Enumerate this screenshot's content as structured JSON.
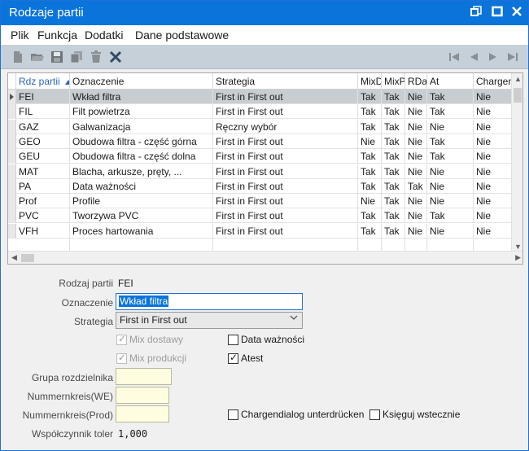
{
  "window": {
    "title": "Rodzaje partii",
    "controls": [
      "restore-icon",
      "maximize-icon",
      "close-icon"
    ]
  },
  "menu": {
    "items": [
      "Plik",
      "Funkcja",
      "Dodatki",
      "Dane podstawowe"
    ]
  },
  "toolbar": {
    "left_icons": [
      "new-document-icon",
      "open-folder-icon",
      "save-icon",
      "copy-icon",
      "delete-icon",
      "cancel-icon"
    ],
    "right_icons": [
      "first-record-icon",
      "previous-record-icon",
      "next-record-icon",
      "last-record-icon"
    ]
  },
  "grid": {
    "columns": [
      "Rdz partii",
      "Oznaczenie",
      "Strategia",
      "MixD",
      "MixP",
      "RDaW",
      "At",
      "Chargen"
    ],
    "sorted_column": "Rdz partii",
    "sort_direction": "ascending",
    "selected_row": 0,
    "rows": [
      [
        "FEI",
        "Wkład filtra",
        "First in First out",
        "Tak",
        "Tak",
        "Nie",
        "Tak",
        "Nie"
      ],
      [
        "FIL",
        "Filt powietrza",
        "First in First out",
        "Tak",
        "Tak",
        "Nie",
        "Tak",
        "Nie"
      ],
      [
        "GAZ",
        "Galwanizacja",
        "Ręczny wybór",
        "Tak",
        "Tak",
        "Nie",
        "Nie",
        "Nie"
      ],
      [
        "GEO",
        "Obudowa filtra - część górna",
        "First in First out",
        "Nie",
        "Tak",
        "Nie",
        "Tak",
        "Nie"
      ],
      [
        "GEU",
        "Obudowa filtra - część dolna",
        "First in First out",
        "Tak",
        "Tak",
        "Nie",
        "Tak",
        "Nie"
      ],
      [
        "MAT",
        "Blacha, arkusze, pręty, ...",
        "First in First out",
        "Tak",
        "Tak",
        "Nie",
        "Nie",
        "Nie"
      ],
      [
        "PA",
        "Data ważności",
        "First in First out",
        "Tak",
        "Tak",
        "Tak",
        "Nie",
        "Nie"
      ],
      [
        "Prof",
        "Profile",
        "First in First out",
        "Nie",
        "Tak",
        "Nie",
        "Nie",
        "Nie"
      ],
      [
        "PVC",
        "Tworzywa PVC",
        "First in First out",
        "Tak",
        "Tak",
        "Nie",
        "Tak",
        "Nie"
      ],
      [
        "VFH",
        "Proces hartowania",
        "First in First out",
        "Tak",
        "Tak",
        "Nie",
        "Nie",
        "Nie"
      ]
    ]
  },
  "form": {
    "rodzaj_label": "Rodzaj partii",
    "rodzaj_value": "FEI",
    "oznaczenie_label": "Oznaczenie",
    "oznaczenie_value": "Wkład filtra",
    "strategia_label": "Strategia",
    "strategia_value": "First in First out",
    "mix_dostawy_label": "Mix dostawy",
    "mix_dostawy_checked": true,
    "mix_produkcji_label": "Mix produkcji",
    "mix_produkcji_checked": true,
    "data_waznosci_label": "Data ważności",
    "data_waznosci_checked": false,
    "atest_label": "Atest",
    "atest_checked": true,
    "grupa_label": "Grupa rozdzielnika",
    "grupa_value": "",
    "nummernkreis_we_label": "Nummernkreis(WE)",
    "nummernkreis_we_value": "",
    "nummernkreis_prod_label": "Nummernkreis(Prod)",
    "nummernkreis_prod_value": "",
    "chargendialog_label": "Chargendialog unterdrücken",
    "chargendialog_checked": false,
    "ksieguj_label": "Księguj wstecznie",
    "ksieguj_checked": false,
    "wspolczynnik_label": "Współczynnik toler",
    "wspolczynnik_value": "1,000"
  },
  "colors": {
    "titlebar": "#0a74da",
    "toolbar": "#c6d0d8",
    "selected_row": "#c8cdd2",
    "yellow_field": "#fffde0",
    "sort_header": "#2a64c4"
  }
}
